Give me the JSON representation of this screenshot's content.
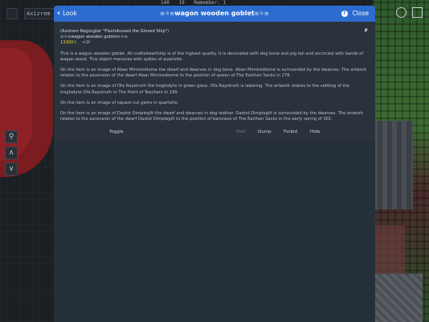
{
  "hud": {
    "left_label": "Axizrem Re",
    "stats": [
      "140",
      "19",
      "Remember: 1"
    ]
  },
  "nav": {
    "buttons": [
      "⚲",
      "∧",
      "∨"
    ]
  },
  "modal": {
    "back_label": "Look",
    "title_prefix": "≡☼≡",
    "title_text": "wagon wooden goblet",
    "title_suffix": "≡☼≡",
    "close_label": "Close",
    "help_label": "?",
    "corner_flag": "F",
    "owner_line": "(Axizrem Regzugtar \"Flashdoused the Gloved Ship\")",
    "item_line": "≡☼≡wagon wooden goblet≡☼≡",
    "value": "13200☼",
    "value_tag": "<1f",
    "paragraphs": [
      "This is a wagon wooden goblet. All craftsdwarfship is of the highest quality. It is decorated with dog bone and pig tail and encircled with bands of wagon wood. This object menaces with spikes of quartzite.",
      "On the item is an image of Aban Mirroredtome the dwarf and dwarves in dog bone. Aban Mirroredtome is surrounded by the dwarves. The artwork relates to the ascension of the dwarf Aban Mirroredtome to the position of queen of The Earthen Sacks in 278.",
      "On the item is an image of Ofa Raystruth the troglodyte in green glass. Ofa Raystruth is laboring. The artwork relates to the settling of the troglodyte Ofa Raystruth in The Point of Teachers in 199.",
      "On the item is an image of square cut gems in quartzite.",
      "On the item is an image of Dastot Dimplegilt the dwarf and dwarves in dog leather. Dastot Dimplegilt is surrounded by the dwarves. The artwork relates to the ascension of the dwarf Dastot Dimplegilt to the position of baroness of The Earthen Sacks in the early spring of 301."
    ],
    "toggle_label": "Toggle",
    "actions": {
      "melt": "Melt",
      "dump": "Dump",
      "forbid": "Forbid",
      "hide": "Hide"
    }
  },
  "colors": {
    "header": "#2c6ccf",
    "panel": "#2a323c",
    "value": "#e8d64a"
  }
}
